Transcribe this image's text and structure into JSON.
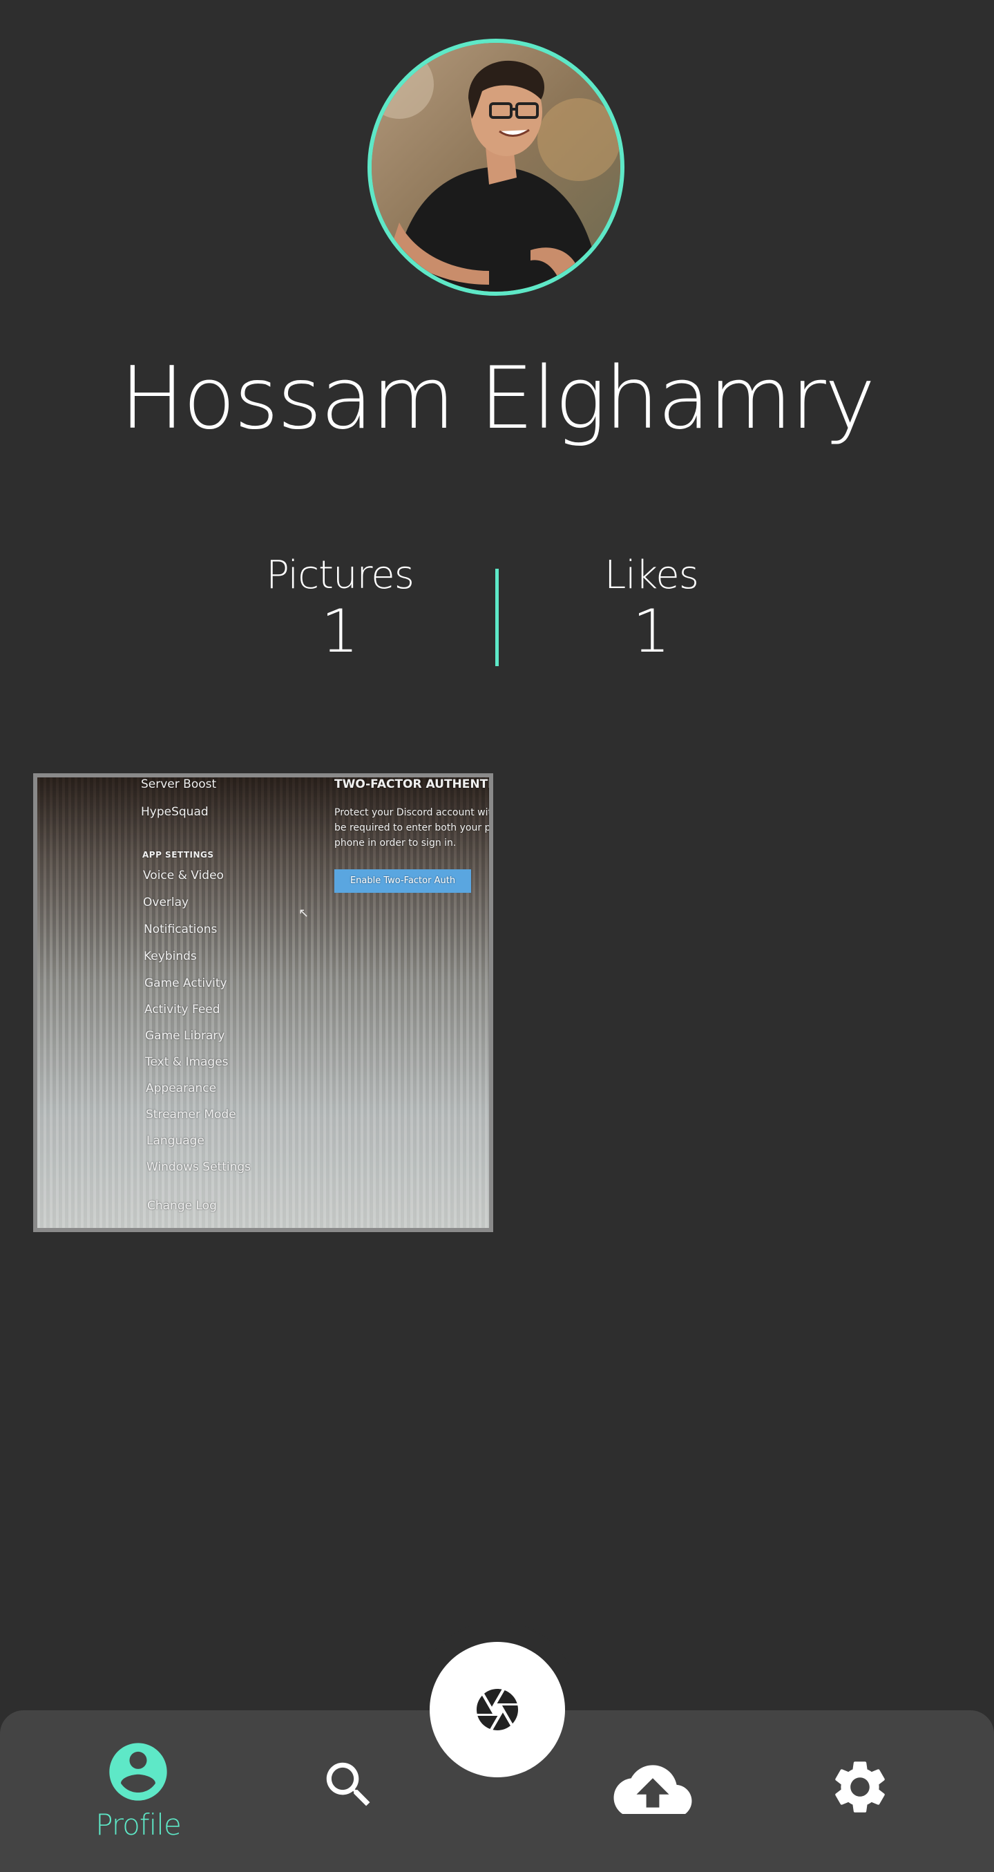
{
  "profile": {
    "name": "Hossam Elghamry",
    "avatar_icon": "user-photo"
  },
  "stats": {
    "pictures_label": "Pictures",
    "pictures_value": "1",
    "likes_label": "Likes",
    "likes_value": "1"
  },
  "gallery": {
    "items": [
      {
        "menu": [
          "Server Boost",
          "HypeSquad",
          "APP SETTINGS",
          "Voice & Video",
          "Overlay",
          "Notifications",
          "Keybinds",
          "Game Activity",
          "Activity Feed",
          "Game Library",
          "Text & Images",
          "Appearance",
          "Streamer Mode",
          "Language",
          "Windows Settings",
          "Change Log"
        ],
        "heading": "TWO-FACTOR AUTHENTICA",
        "description": "Protect your Discord account with be required to enter both your pa phone in order to sign in.",
        "button": "Enable Two-Factor Auth"
      }
    ]
  },
  "nav": {
    "profile_label": "Profile",
    "items": [
      "profile-icon",
      "search-icon",
      "camera-shutter-icon",
      "cloud-upload-icon",
      "gear-icon"
    ]
  },
  "colors": {
    "background": "#2e2e2e",
    "accent": "#5ee8c7",
    "nav_background": "#444444",
    "text": "#ffffff"
  }
}
